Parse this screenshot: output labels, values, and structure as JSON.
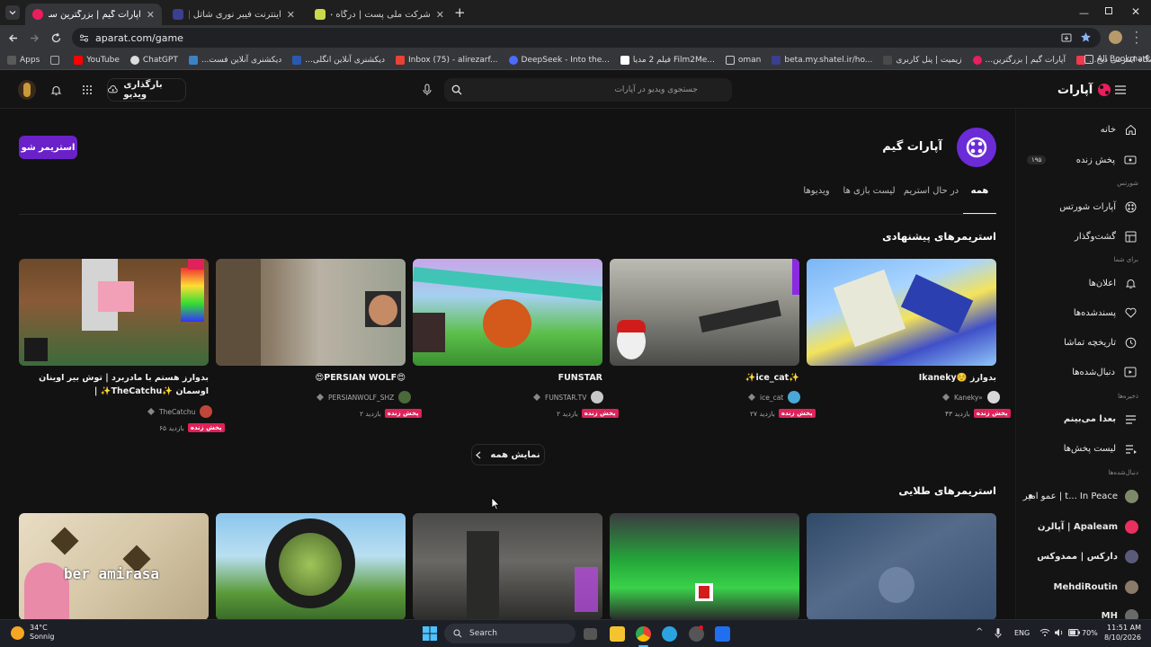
{
  "browser": {
    "tabs": [
      {
        "title": "آپارات گیم | بزرگترین سرویس اشتر",
        "active": true
      },
      {
        "title": "اینترنت فیبر نوری شاتل | شاتل: ش"
      },
      {
        "title": "شرکت ملی پست | درگاه خدمات ا"
      }
    ],
    "new_tab": "+",
    "url": "aparat.com/game",
    "bookmarks": [
      "Apps",
      "YouTube",
      "ChatGPT",
      "دیکشنری آنلاین فست...",
      "دیکشنری آنلاین انگلی...",
      "Inbox (75) - alirezarf...",
      "DeepSeek - Into the...",
      "فیلم 2 مدیا Film2Me...",
      "oman",
      "beta.my.shatel.ir/ho...",
      "زیمیت | پنل کاربری",
      "آپارات گیم | بزرگترین...",
      "فروشگاه اینترنتی دیج..."
    ],
    "all_bookmarks": "All Bookmarks"
  },
  "header": {
    "logo_text": "آپارات",
    "search_placeholder": "جستجوی ویدیو در آپارات",
    "upload_label": "بارگذاری ویدیو"
  },
  "sidebar": {
    "items_top": [
      {
        "label": "خانه",
        "icon": "home-icon"
      },
      {
        "label": "پخش زنده",
        "icon": "live-icon",
        "badge": "۱۹۵"
      }
    ],
    "caption_shorts": "شورتس",
    "items_shorts": [
      {
        "label": "آپارات شورتس",
        "icon": "shorts-icon"
      },
      {
        "label": "گشت‌وگذار",
        "icon": "explore-icon"
      }
    ],
    "caption_foryou": "برای شما",
    "items_foryou": [
      {
        "label": "اعلان‌ها",
        "icon": "bell-icon"
      },
      {
        "label": "پسندشده‌ها",
        "icon": "heart-icon"
      },
      {
        "label": "تاریخچه تماشا",
        "icon": "history-icon"
      },
      {
        "label": "دنبال‌شده‌ها",
        "icon": "following-icon"
      }
    ],
    "caption_saved": "ذخیره‌ها",
    "items_saved": [
      {
        "label": "بعدا می‌بینم",
        "icon": "watch-later-icon"
      },
      {
        "label": "لیست پخش‌ها",
        "icon": "playlist-icon"
      }
    ],
    "caption_following": "دنبال‌شده‌ها",
    "subs": [
      {
        "label": "عمو امیر | t... In Peace",
        "color": "#7d8a6a"
      },
      {
        "label": "آپالرن | Apaleam",
        "color": "#e9305f"
      },
      {
        "label": "دارکس | ممدوکس",
        "color": "#5a5a7a"
      },
      {
        "label": "MehdiRoutin",
        "color": "#8a7a6a"
      },
      {
        "label": "MH",
        "color": "#6a6a6a"
      }
    ]
  },
  "channel": {
    "name": "آپارات گیم",
    "streamer_button": "استریمر شو",
    "tabs": [
      "همه",
      "در حال استریم",
      "لیست بازی ها",
      "ویدیوها"
    ]
  },
  "section1": {
    "title": "استریمرهای پیشنهادی",
    "show_all": "نمایش همه",
    "cards": [
      {
        "title": "Ikaneky☺️ بدوارز",
        "channel": "Kaneky»",
        "live": "پخش زنده",
        "viewers": "۴۳ بازدید"
      },
      {
        "title": "✨ice_cat✨",
        "channel": "ice_cat",
        "live": "پخش زنده",
        "viewers": "۲۷ بازدید"
      },
      {
        "title": "FUNSTAR",
        "channel": "FUNSTAR.TV",
        "live": "پخش زنده",
        "viewers": "۲ بازدید"
      },
      {
        "title": "😍PERSIAN WOLF😍",
        "channel": "PERSIANWOLF_SHZ",
        "live": "پخش زنده",
        "viewers": "۲ بازدید"
      },
      {
        "title": "بدوارز هستم با مادربرد | توش بیر اوینان اوسمان ✨TheCatchu✨ |",
        "channel": "TheCatchu",
        "live": "پخش زنده",
        "viewers": "۶۵ بازدید"
      }
    ]
  },
  "section2": {
    "title": "استریمرهای طلایی"
  },
  "taskbar": {
    "weather_temp": "34°C",
    "weather_text": "Sonnig",
    "search_label": "Search",
    "lang": "ENG",
    "battery": "70%",
    "time": "11:51 AM",
    "date": "8/10/2026"
  }
}
